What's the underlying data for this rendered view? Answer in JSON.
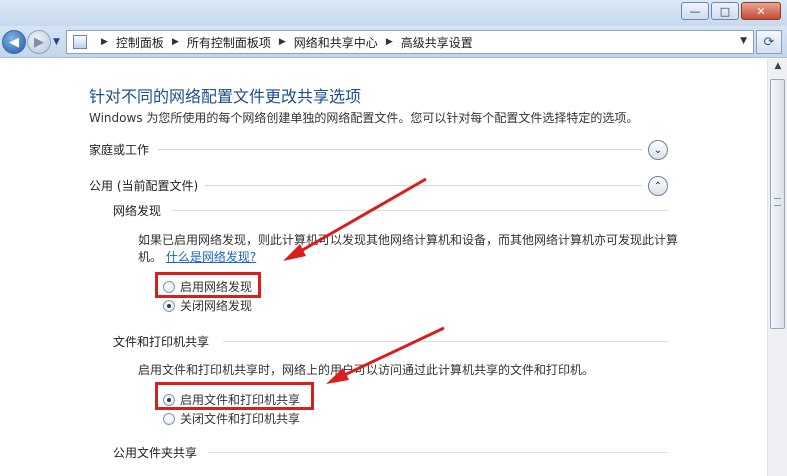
{
  "breadcrumb": [
    "控制面板",
    "所有控制面板项",
    "网络和共享中心",
    "高级共享设置"
  ],
  "window_buttons": {
    "minimize": "—",
    "maximize": "□",
    "close": "✕"
  },
  "page": {
    "title": "针对不同的网络配置文件更改共享选项",
    "description": "Windows 为您所使用的每个网络创建单独的网络配置文件。您可以针对每个配置文件选择特定的选项。"
  },
  "profiles": {
    "home_work": {
      "label": "家庭或工作",
      "expanded": false
    },
    "public": {
      "label": "公用 (当前配置文件)",
      "expanded": true
    }
  },
  "network_discovery": {
    "heading": "网络发现",
    "description": "如果已启用网络发现，则此计算机可以发现其他网络计算机和设备，而其他网络计算机亦可发现此计算机。",
    "help_link": "什么是网络发现?",
    "options": [
      {
        "label": "启用网络发现",
        "selected": false
      },
      {
        "label": "关闭网络发现",
        "selected": true
      }
    ]
  },
  "file_printer_sharing": {
    "heading": "文件和打印机共享",
    "description": "启用文件和打印机共享时，网络上的用户可以访问通过此计算机共享的文件和打印机。",
    "options": [
      {
        "label": "启用文件和打印机共享",
        "selected": true
      },
      {
        "label": "关闭文件和打印机共享",
        "selected": false
      }
    ]
  },
  "public_folder_sharing": {
    "heading": "公用文件夹共享"
  },
  "icons": {
    "back": "back-arrow-icon",
    "forward": "forward-arrow-icon",
    "refresh": "refresh-icon",
    "expand": "chevron-down-icon",
    "collapse": "chevron-up-icon"
  },
  "colors": {
    "title": "#1e4e8c",
    "link": "#1a64c2",
    "annotation": "#d91e1e"
  }
}
